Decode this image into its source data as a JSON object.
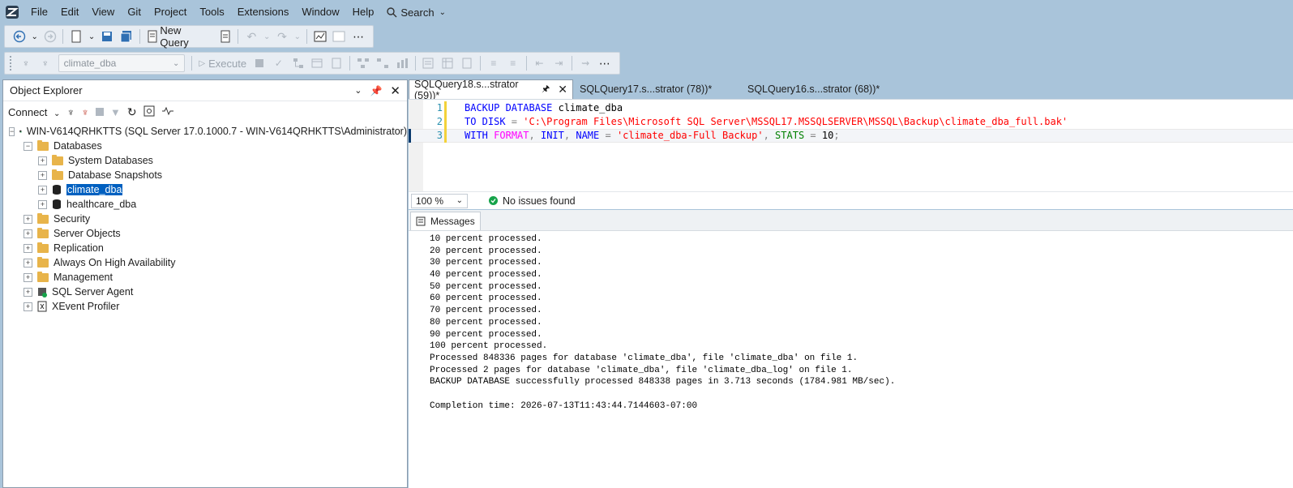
{
  "menu": {
    "items": [
      "File",
      "Edit",
      "View",
      "Git",
      "Project",
      "Tools",
      "Extensions",
      "Window",
      "Help"
    ],
    "search_label": "Search"
  },
  "toolbar": {
    "new_query_label": "New Query",
    "database_selected": "climate_dba",
    "execute_label": "Execute"
  },
  "object_explorer": {
    "title": "Object Explorer",
    "connect_label": "Connect",
    "server": "WIN-V614QRHKTTS (SQL Server 17.0.1000.7 - WIN-V614QRHKTTS\\Administrator)",
    "nodes": {
      "databases": "Databases",
      "system_databases": "System Databases",
      "database_snapshots": "Database Snapshots",
      "climate_dba": "climate_dba",
      "healthcare_dba": "healthcare_dba",
      "security": "Security",
      "server_objects": "Server Objects",
      "replication": "Replication",
      "always_on": "Always On High Availability",
      "management": "Management",
      "sql_server_agent": "SQL Server Agent",
      "xevent_profiler": "XEvent Profiler"
    }
  },
  "tabs": [
    {
      "label": "SQLQuery18.s...strator (59))*",
      "active": true
    },
    {
      "label": "SQLQuery17.s...strator (78))*",
      "active": false
    },
    {
      "label": "SQLQuery16.s...strator (68))*",
      "active": false
    }
  ],
  "editor": {
    "line_numbers": [
      "1",
      "2",
      "3"
    ],
    "line1": {
      "kw1": "BACKUP DATABASE",
      "ident": " climate_dba"
    },
    "line2": {
      "kw1": "TO DISK",
      "op": " = ",
      "str": "'C:\\Program Files\\Microsoft SQL Server\\MSSQL17.MSSQLSERVER\\MSSQL\\Backup\\climate_dba_full.bak'"
    },
    "line3": {
      "kw_with": "WITH",
      "fn_format": "FORMAT",
      "kw_init": "INIT",
      "kw_name": "NAME",
      "str_name": "'climate_dba-Full Backup'",
      "kw_stats": "STATS",
      "num": "10"
    }
  },
  "status": {
    "zoom": "100 %",
    "issues": "No issues found"
  },
  "messages": {
    "tab_label": "Messages",
    "lines": [
      "10 percent processed.",
      "20 percent processed.",
      "30 percent processed.",
      "40 percent processed.",
      "50 percent processed.",
      "60 percent processed.",
      "70 percent processed.",
      "80 percent processed.",
      "90 percent processed.",
      "100 percent processed.",
      "Processed 848336 pages for database 'climate_dba', file 'climate_dba' on file 1.",
      "Processed 2 pages for database 'climate_dba', file 'climate_dba_log' on file 1.",
      "BACKUP DATABASE successfully processed 848338 pages in 3.713 seconds (1784.981 MB/sec).",
      "",
      "Completion time: 2026-07-13T11:43:44.7144603-07:00"
    ]
  },
  "colors": {
    "keyword": "#0000ff",
    "function": "#ff00ff",
    "string": "#ff0000",
    "selection": "#0060c0",
    "ok": "#16a34a"
  }
}
